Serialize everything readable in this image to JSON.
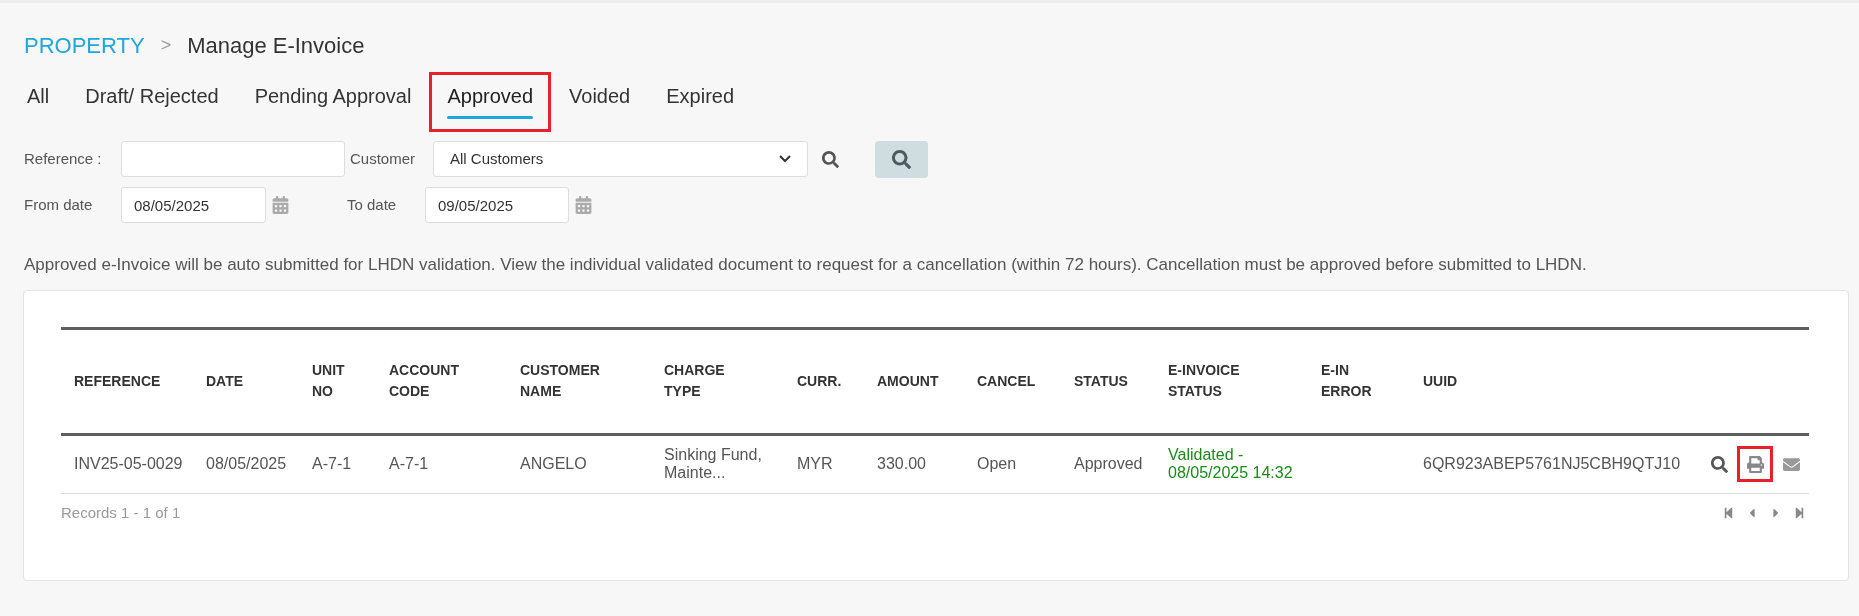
{
  "breadcrumb": {
    "section": "PROPERTY",
    "separator": ">",
    "page": "Manage E-Invoice"
  },
  "tabs": [
    {
      "label": "All",
      "selected": false,
      "highlighted": false
    },
    {
      "label": "Draft/ Rejected",
      "selected": false,
      "highlighted": false
    },
    {
      "label": "Pending Approval",
      "selected": false,
      "highlighted": false
    },
    {
      "label": "Approved",
      "selected": true,
      "highlighted": true
    },
    {
      "label": "Voided",
      "selected": false,
      "highlighted": false
    },
    {
      "label": "Expired",
      "selected": false,
      "highlighted": false
    }
  ],
  "filters": {
    "reference": {
      "label": "Reference :"
    },
    "customer": {
      "label": "Customer",
      "value": "All Customers"
    },
    "from_date": {
      "label": "From date",
      "value": "08/05/2025"
    },
    "to_date": {
      "label": "To date",
      "value": "09/05/2025"
    }
  },
  "note": "Approved e-Invoice will be auto submitted for LHDN validation. View the individual validated document to request for a cancellation (within 72 hours). Cancellation must be approved before submitted to LHDN.",
  "table": {
    "columns": [
      "REFERENCE",
      "DATE",
      "UNIT NO",
      "ACCOUNT CODE",
      "CUSTOMER NAME",
      "CHARGE TYPE",
      "CURR.",
      "AMOUNT",
      "CANCEL",
      "STATUS",
      "E-INVOICE STATUS",
      "E-IN ERROR",
      "UUID"
    ],
    "rows": [
      {
        "cells": [
          "INV25-05-0029",
          "08/05/2025",
          "A-7-1",
          "A-7-1",
          "ANGELO",
          "Sinking Fund, Mainte...",
          "MYR",
          "330.00",
          "Open",
          "Approved",
          "Validated - 08/05/2025 14:32",
          null,
          "6QR923ABEP5761NJ5CBH9QTJ10"
        ],
        "validated": true,
        "actions": [
          {
            "kind": "view",
            "highlighted": false
          },
          {
            "kind": "print",
            "highlighted": true
          },
          {
            "kind": "email",
            "highlighted": false
          }
        ]
      }
    ],
    "records": "Records 1 - 1 of 1"
  }
}
